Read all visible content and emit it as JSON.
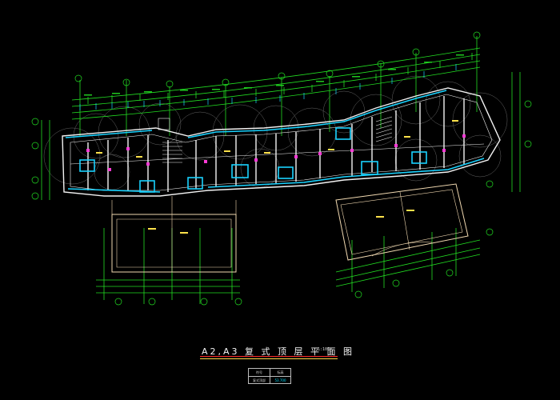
{
  "drawing": {
    "title": "A2,A3 复 式 顶 层 平 面 图",
    "scale": "1:100",
    "legend": {
      "row1": [
        "符号",
        "标高"
      ],
      "row2": [
        "复式顶部",
        "53.700"
      ]
    }
  },
  "colors": {
    "background": "#000000",
    "walls": "#ffffff",
    "cyan_windows": "#19d3ff",
    "dimension_green": "#22dd22",
    "column_magenta": "#ff3ad6",
    "room_text": "#ffe14a",
    "roof_outline": "#f0d8b0",
    "circles": "#b8b8b8"
  },
  "axis_labels": {
    "top": [
      "1",
      "2",
      "3",
      "11",
      "12",
      "13"
    ],
    "bottom": [
      "5",
      "8",
      "9",
      "4",
      "6",
      "8"
    ],
    "right": [
      "E",
      "C",
      "B",
      "A"
    ],
    "left": [
      "E",
      "C",
      "B",
      "A"
    ]
  },
  "notes": {
    "dims_bottom_left": [
      "3900",
      "3900",
      "3900"
    ],
    "dims_bottom_right": [
      "3900",
      "3900"
    ]
  }
}
